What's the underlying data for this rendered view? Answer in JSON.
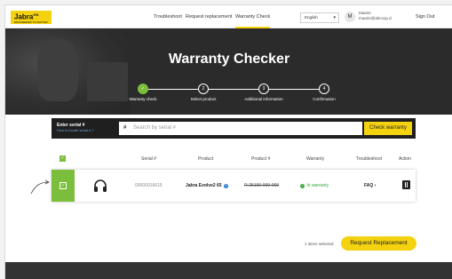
{
  "header": {
    "logo_text": "Jabra",
    "logo_sup": "GN",
    "logo_tagline": "ENGINEERED TO MATTER",
    "nav": [
      "Troubleshoot",
      "Request replacement",
      "Warranty Check"
    ],
    "active_nav": "Warranty Check",
    "language": "English",
    "avatar_initial": "M",
    "user_name": "Maarie",
    "user_email": "maarie@abcsop.d",
    "signout": "Sign Out"
  },
  "hero": {
    "title": "Warranty Checker",
    "steps": [
      {
        "label": "Warranty check",
        "mark": "✓",
        "done": true
      },
      {
        "label": "Select product",
        "mark": "2",
        "done": false
      },
      {
        "label": "Additional information",
        "mark": "3",
        "done": false
      },
      {
        "label": "Confirmation",
        "mark": "4",
        "done": false
      }
    ]
  },
  "search": {
    "title": "Enter serial #",
    "help": "How to locate serial # ?",
    "hash": "#",
    "placeholder": "Search by serial #",
    "button": "Check warranty"
  },
  "table": {
    "headers": [
      "Serial #",
      "Product",
      "Product #",
      "Warranty",
      "Troubleshoot",
      "Action"
    ],
    "check_mark": "✓",
    "rows": [
      {
        "serial": "00000016615",
        "product": "Jabra Evolve2 65",
        "info_icon": "i",
        "product_number": "R-25199-999-999",
        "warranty_mark": "✓",
        "warranty": "In warranty",
        "troubleshoot": "FAQ ›"
      }
    ]
  },
  "footer": {
    "selected_text": "1 items selected",
    "request_button": "Request Replacement"
  },
  "icons": [
    "headset-icon",
    "trash-icon",
    "info-icon",
    "check-icon",
    "chevron-down-icon",
    "arrow-icon"
  ],
  "colors": {
    "brand_yellow": "#f5d20f",
    "success_green": "#7bbe3b",
    "dark": "#2b2b2b"
  }
}
